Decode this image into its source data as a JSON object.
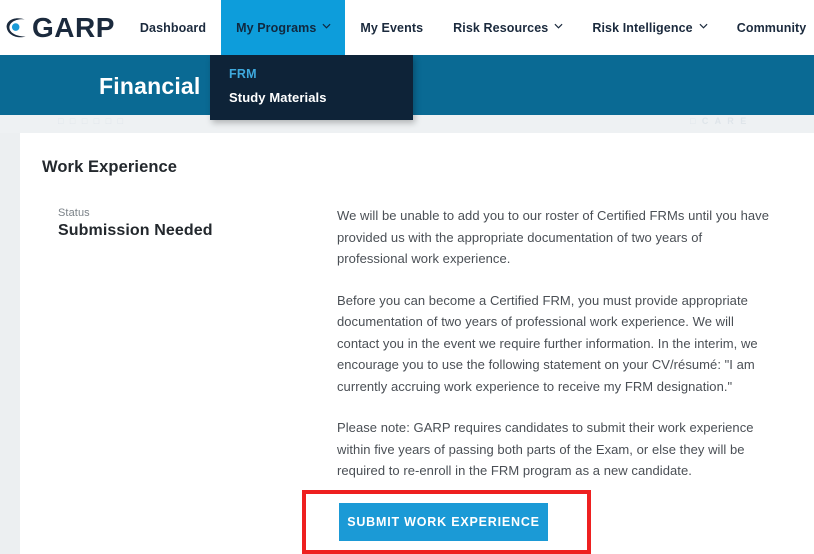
{
  "brand": {
    "logo_text": "GARP",
    "logo_icon": "garp-eye-icon"
  },
  "nav": {
    "items": [
      {
        "label": "Dashboard",
        "has_caret": false,
        "active": false
      },
      {
        "label": "My Programs",
        "has_caret": true,
        "active": true
      },
      {
        "label": "My Events",
        "has_caret": false,
        "active": false
      },
      {
        "label": "Risk Resources",
        "has_caret": true,
        "active": false
      },
      {
        "label": "Risk Intelligence",
        "has_caret": true,
        "active": false
      },
      {
        "label": "Community",
        "has_caret": false,
        "active": false
      }
    ],
    "active_bg": "#0d9ddb",
    "caret_icon": "chevron-down-icon"
  },
  "dropdown": {
    "group_label": "FRM",
    "items": [
      {
        "label": "Study Materials"
      }
    ],
    "bg": "#0e2338",
    "group_color": "#3ea9dd"
  },
  "banner": {
    "title": "Financial",
    "bg": "#0a6a94"
  },
  "ghost": {
    "left_text": "□ □   □ □ □ □",
    "right_text": "□   C A R E"
  },
  "main": {
    "page_title": "Work Experience",
    "status_label": "Status",
    "status_value": "Submission Needed",
    "paragraphs": [
      "We will be unable to add you to our roster of Certified FRMs until you have provided us with the appropriate documentation of two years of professional work experience.",
      "Before you can become a Certified FRM, you must provide appropriate documentation of two years of professional work experience. We will contact you in the event we require further information. In the interim, we encourage you to use the following statement on your CV/résumé: \"I am currently accruing work experience to receive my FRM designation.\"",
      "Please note: GARP requires candidates to submit their work experience within five years of passing both parts of the Exam, or else they will be required to re-enroll in the FRM program as a new candidate."
    ],
    "submit_button_label": "SUBMIT WORK EXPERIENCE",
    "submit_button_color": "#1b9ad6"
  },
  "annotation": {
    "highlight_color": "#ee2020"
  }
}
